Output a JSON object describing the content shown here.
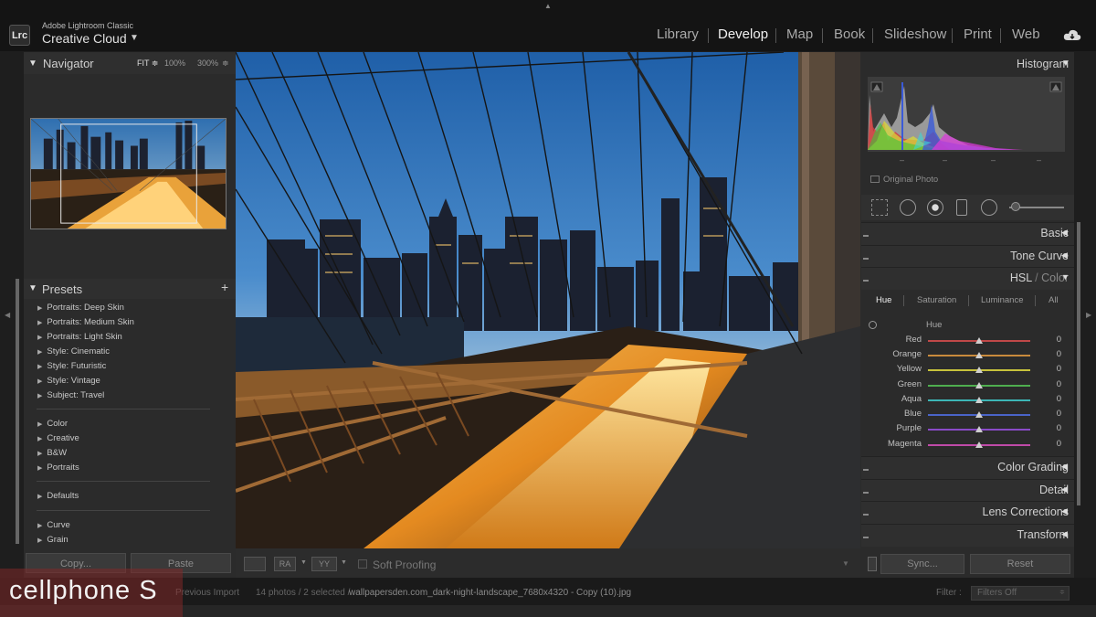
{
  "app": {
    "name": "Adobe Lightroom Classic",
    "sub": "Creative Cloud",
    "logo": "Lrc"
  },
  "modules": [
    "Library",
    "Develop",
    "Map",
    "Book",
    "Slideshow",
    "Print",
    "Web"
  ],
  "active_module": "Develop",
  "navigator": {
    "title": "Navigator",
    "zoom": [
      "FIT ≑",
      "100%",
      "300%",
      "≑"
    ]
  },
  "presets": {
    "title": "Presets",
    "add": "+",
    "group1": [
      "Portraits: Deep Skin",
      "Portraits: Medium Skin",
      "Portraits: Light Skin",
      "Style: Cinematic",
      "Style: Futuristic",
      "Style: Vintage",
      "Subject: Travel"
    ],
    "group2": [
      "Color",
      "Creative",
      "B&W",
      "Portraits"
    ],
    "group3": [
      "Defaults"
    ],
    "group4": [
      "Curve",
      "Grain"
    ]
  },
  "left_buttons": {
    "copy": "Copy...",
    "paste": "Paste"
  },
  "toolbar": {
    "soft_proofing": "Soft Proofing",
    "ba": "RA",
    "yy": "YY"
  },
  "histogram": {
    "title": "Histogram",
    "original_photo": "Original Photo",
    "ticks": [
      "–",
      "–",
      "–",
      "–"
    ]
  },
  "right_sections": {
    "basic": "Basic",
    "tone_curve": "Tone Curve",
    "hsl": "HSL",
    "hsl_sep": " / ",
    "color": "Color",
    "color_grading": "Color Grading",
    "detail": "Detail",
    "lens_corrections": "Lens Corrections",
    "transform": "Transform"
  },
  "hsl_tabs": [
    "Hue",
    "Saturation",
    "Luminance",
    "All"
  ],
  "hsl_active_tab": "Hue",
  "hsl_panel_title": "Hue",
  "hsl_sliders": [
    {
      "name": "Red",
      "value": "0",
      "color": "#c04848"
    },
    {
      "name": "Orange",
      "value": "0",
      "color": "#c98a3c"
    },
    {
      "name": "Yellow",
      "value": "0",
      "color": "#c8c23c"
    },
    {
      "name": "Green",
      "value": "0",
      "color": "#4fae4f"
    },
    {
      "name": "Aqua",
      "value": "0",
      "color": "#3cb5b5"
    },
    {
      "name": "Blue",
      "value": "0",
      "color": "#4a64c8"
    },
    {
      "name": "Purple",
      "value": "0",
      "color": "#8a4ac8"
    },
    {
      "name": "Magenta",
      "value": "0",
      "color": "#c04aa8"
    }
  ],
  "right_buttons": {
    "sync": "Sync...",
    "reset": "Reset"
  },
  "status": {
    "prev": "Previous Import",
    "count": "14 photos / 2 selected /",
    "file": "wallpapersden.com_dark-night-landscape_7680x4320 - Copy (10).jpg",
    "filter_label": "Filter :",
    "filter_value": "Filters Off"
  },
  "watermark": "cellphone S",
  "colors": {
    "accent": "#f0f0f0",
    "panel": "#2b2b2b",
    "watermark_bg": "#8a2828"
  }
}
